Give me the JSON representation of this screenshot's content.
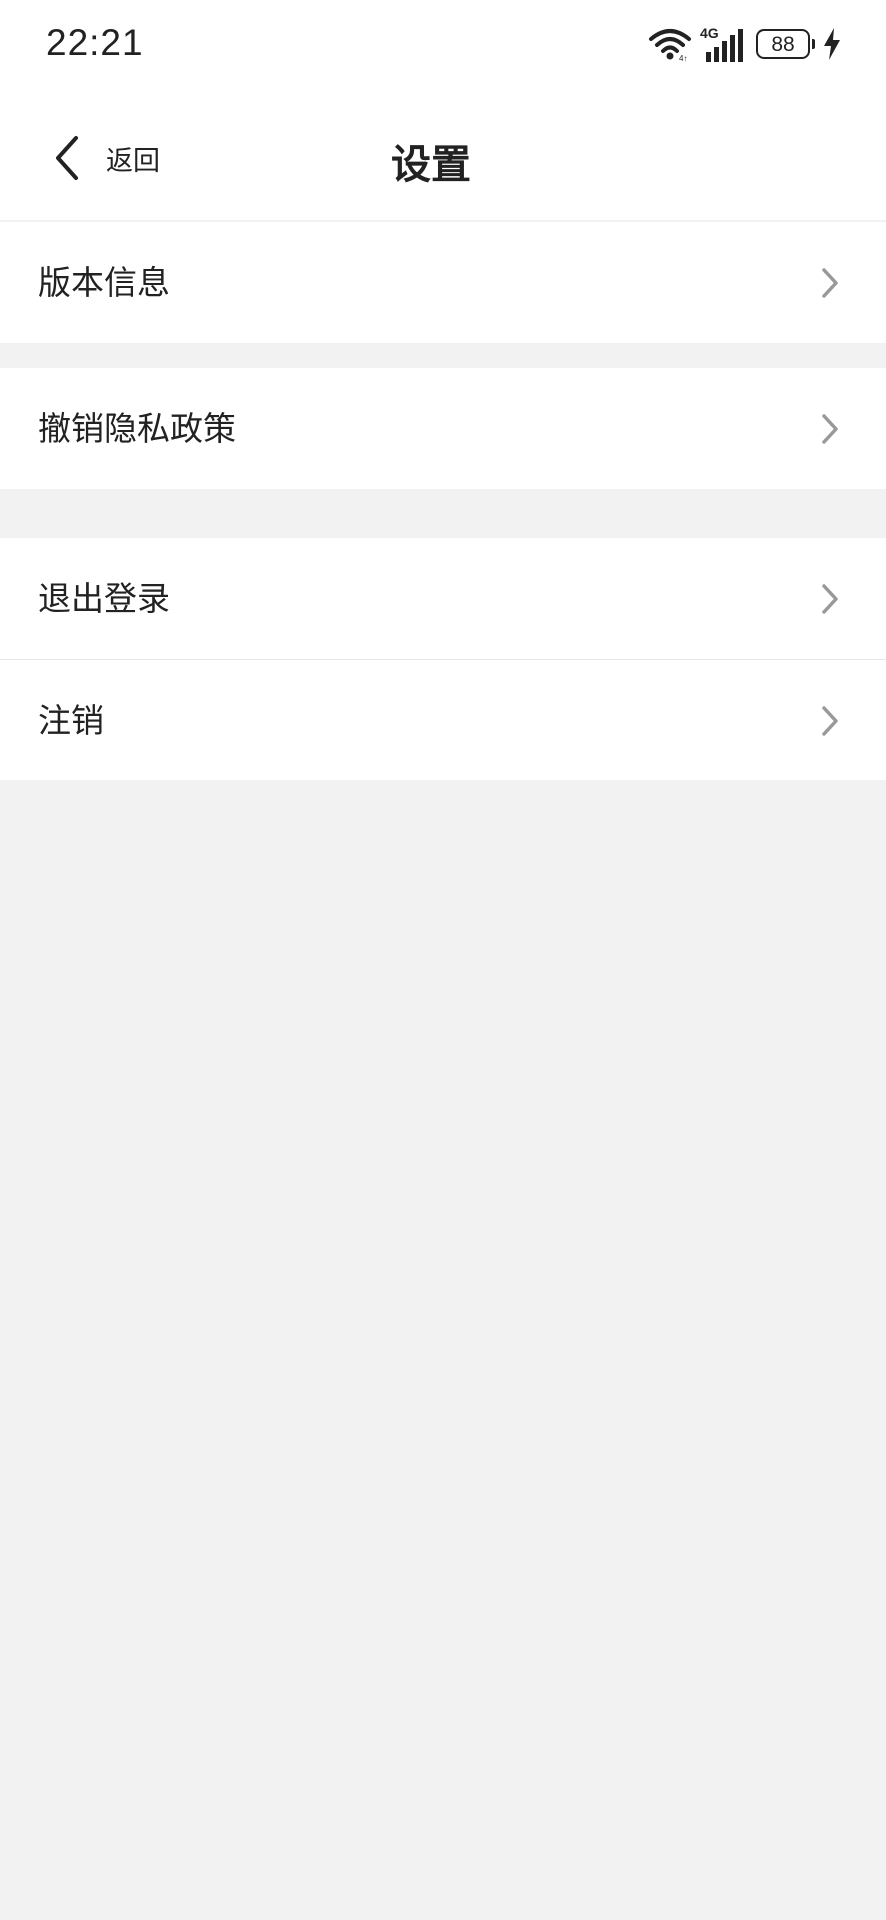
{
  "status_bar": {
    "time": "22:21",
    "network": "4G",
    "battery": "88",
    "icons": [
      "wifi-icon",
      "signal-icon",
      "battery-icon",
      "charging-icon"
    ]
  },
  "header": {
    "back_label": "返回",
    "title": "设置",
    "icon": "chevron-left-icon"
  },
  "settings": {
    "groups": [
      {
        "items": [
          {
            "label": "版本信息",
            "icon": "chevron-right-icon"
          }
        ]
      },
      {
        "items": [
          {
            "label": "撤销隐私政策",
            "icon": "chevron-right-icon"
          }
        ]
      },
      {
        "items": [
          {
            "label": "退出登录",
            "icon": "chevron-right-icon"
          },
          {
            "label": "注销",
            "icon": "chevron-right-icon"
          }
        ]
      }
    ]
  },
  "colors": {
    "background": "#f2f2f2",
    "surface": "#ffffff",
    "text": "#222222",
    "arrow": "#999999",
    "divider": "#e6e6e6"
  }
}
